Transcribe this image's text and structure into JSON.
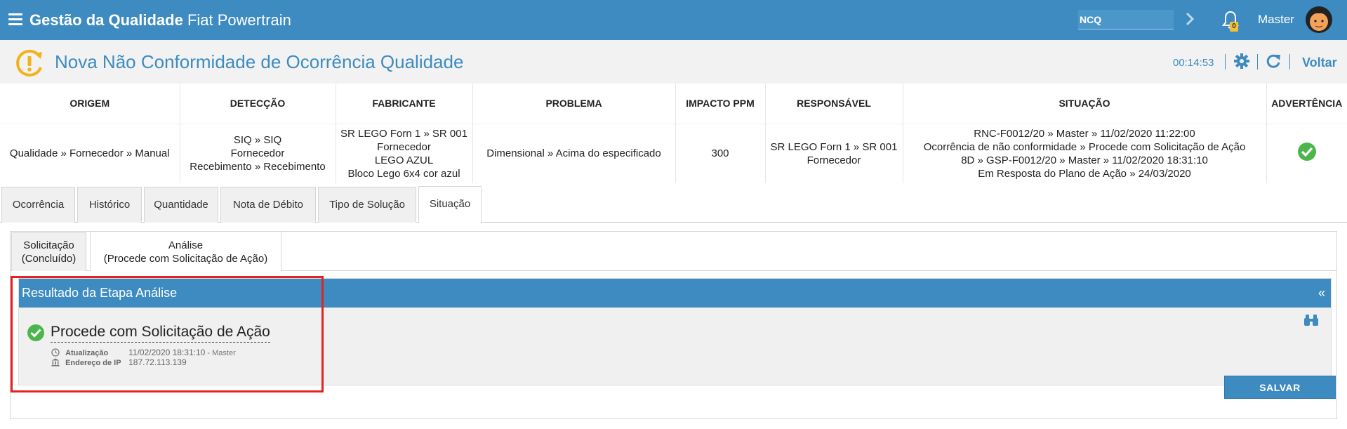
{
  "app": {
    "brand_bold": "Gestão da Qualidade",
    "brand_light": "Fiat Powertrain",
    "search_value": "NCQ",
    "notifications_count": "0",
    "user_name": "Master",
    "accent_color": "#3d8bc0"
  },
  "page": {
    "title": "Nova Não Conformidade de Ocorrência Qualidade",
    "timer": "00:14:53",
    "back_label": "Voltar"
  },
  "info": {
    "headers": {
      "origem": "ORIGEM",
      "deteccao": "DETECÇÃO",
      "fabricante": "FABRICANTE",
      "problema": "PROBLEMA",
      "impacto": "IMPACTO PPM",
      "responsavel": "RESPONSÁVEL",
      "situacao": "SITUAÇÃO",
      "advertencia": "ADVERTÊNCIA"
    },
    "origem": "Qualidade » Fornecedor » Manual",
    "deteccao": [
      "SIQ » SIQ",
      "Fornecedor",
      "Recebimento » Recebimento"
    ],
    "fabricante": [
      "SR LEGO Forn 1 » SR 001",
      "Fornecedor",
      "LEGO AZUL",
      "Bloco Lego 6x4 cor azul"
    ],
    "problema": "Dimensional » Acima do especificado",
    "impacto": "300",
    "responsavel": [
      "SR LEGO Forn 1 » SR 001",
      "Fornecedor"
    ],
    "situacao": [
      "RNC-F0012/20 » Master » 11/02/2020 11:22:00",
      "Ocorrência de não conformidade » Procede com Solicitação de Ação",
      "8D » GSP-F0012/20 » Master » 11/02/2020 18:31:10",
      "Em Resposta do Plano de Ação » 24/03/2020"
    ],
    "advertencia_icon": "check-circle-icon"
  },
  "tabs": [
    "Ocorrência",
    "Histórico",
    "Quantidade",
    "Nota de Débito",
    "Tipo de Solução",
    "Situação"
  ],
  "active_tab": "Situação",
  "subtabs": [
    {
      "line1": "Solicitação",
      "line2": "(Concluído)"
    },
    {
      "line1": "Análise",
      "line2": "(Procede com Solicitação de Ação)"
    }
  ],
  "result": {
    "header": "Resultado da Etapa Análise",
    "collapse_glyph": "«",
    "title": "Procede com Solicitação de Ação",
    "update_label": "Atualização",
    "update_value": "11/02/2020 18:31:10",
    "update_user": "- Master",
    "ip_label": "Endereço de IP",
    "ip_value": "187.72.113.139",
    "save_label": "SALVAR"
  }
}
